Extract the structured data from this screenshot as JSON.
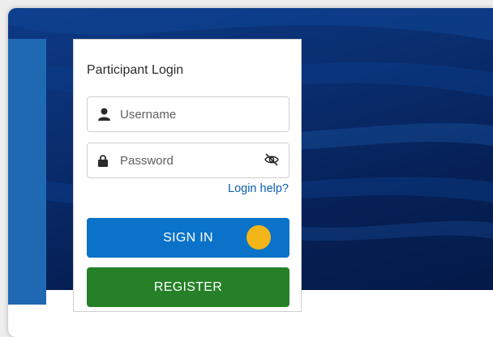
{
  "login": {
    "title": "Participant Login",
    "username": {
      "placeholder": "Username",
      "icon": "user-icon",
      "value": ""
    },
    "password": {
      "placeholder": "Password",
      "icon": "lock-icon",
      "toggle_icon": "eye-slash-icon",
      "value": ""
    },
    "help_link": "Login help?",
    "sign_in_label": "SIGN IN",
    "register_label": "REGISTER"
  },
  "colors": {
    "hero_background": "#0a2e70",
    "side_stripe": "#1f69b3",
    "sign_in_button": "#0a72c8",
    "register_button": "#258028",
    "link": "#0a5fb4",
    "cursor_marker": "#f2b619"
  }
}
